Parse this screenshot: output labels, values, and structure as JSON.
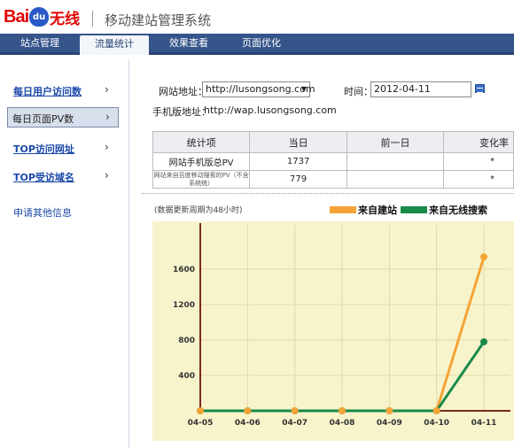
{
  "header": {
    "logo_bai": "Bai",
    "logo_du": "du",
    "logo_wx": "无线",
    "system_title": "移动建站管理系统"
  },
  "nav": {
    "tabs": [
      {
        "label": "站点管理"
      },
      {
        "label": "流量统计"
      },
      {
        "label": "效果查看"
      },
      {
        "label": "页面优化"
      }
    ],
    "active_index": 1
  },
  "sidebar": {
    "items": [
      {
        "label": "每日用户访问数",
        "chevron": "›"
      },
      {
        "label": "每日页面PV数",
        "chevron": "›"
      },
      {
        "label": "TOP访问网址",
        "chevron": "›"
      },
      {
        "label": "TOP受访域名",
        "chevron": "›"
      },
      {
        "label": "申请其他信息",
        "chevron": ""
      }
    ],
    "active_index": 1
  },
  "form": {
    "site_label": "网站地址：",
    "site_value": "http://lusongsong.com",
    "time_label": "时间：",
    "date_value": "2012-04-11",
    "mobile_label": "手机版地址：",
    "mobile_value": "http://wap.lusongsong.com"
  },
  "table": {
    "headers": [
      "统计项",
      "当日",
      "前一日",
      "变化率"
    ],
    "rows": [
      {
        "item": "网站手机版总PV",
        "today": "1737",
        "prev": "",
        "change": "*"
      },
      {
        "item": "网站来自百度移动搜索的PV（不含系统统）",
        "today": "779",
        "prev": "",
        "change": "*"
      }
    ]
  },
  "chart_note": "(数据更新周期为48小时)",
  "colors": {
    "nav_bg": "#35548a",
    "chart_bg": "#f7f4cc",
    "series_site": "#f4a436",
    "series_wireless": "#1a8a4a",
    "axis": "#7a2a1a"
  },
  "chart_data": {
    "type": "line",
    "x": [
      "04-05",
      "04-06",
      "04-07",
      "04-08",
      "04-09",
      "04-10",
      "04-11"
    ],
    "series": [
      {
        "name": "来自建站",
        "values": [
          0,
          0,
          0,
          0,
          0,
          0,
          1737
        ]
      },
      {
        "name": "来自无线搜索",
        "values": [
          0,
          0,
          0,
          0,
          0,
          0,
          779
        ]
      }
    ],
    "yticks": [
      400,
      800,
      1200,
      1600
    ],
    "ylim": [
      0,
      2000
    ],
    "grid": true,
    "legend": "top-right"
  }
}
